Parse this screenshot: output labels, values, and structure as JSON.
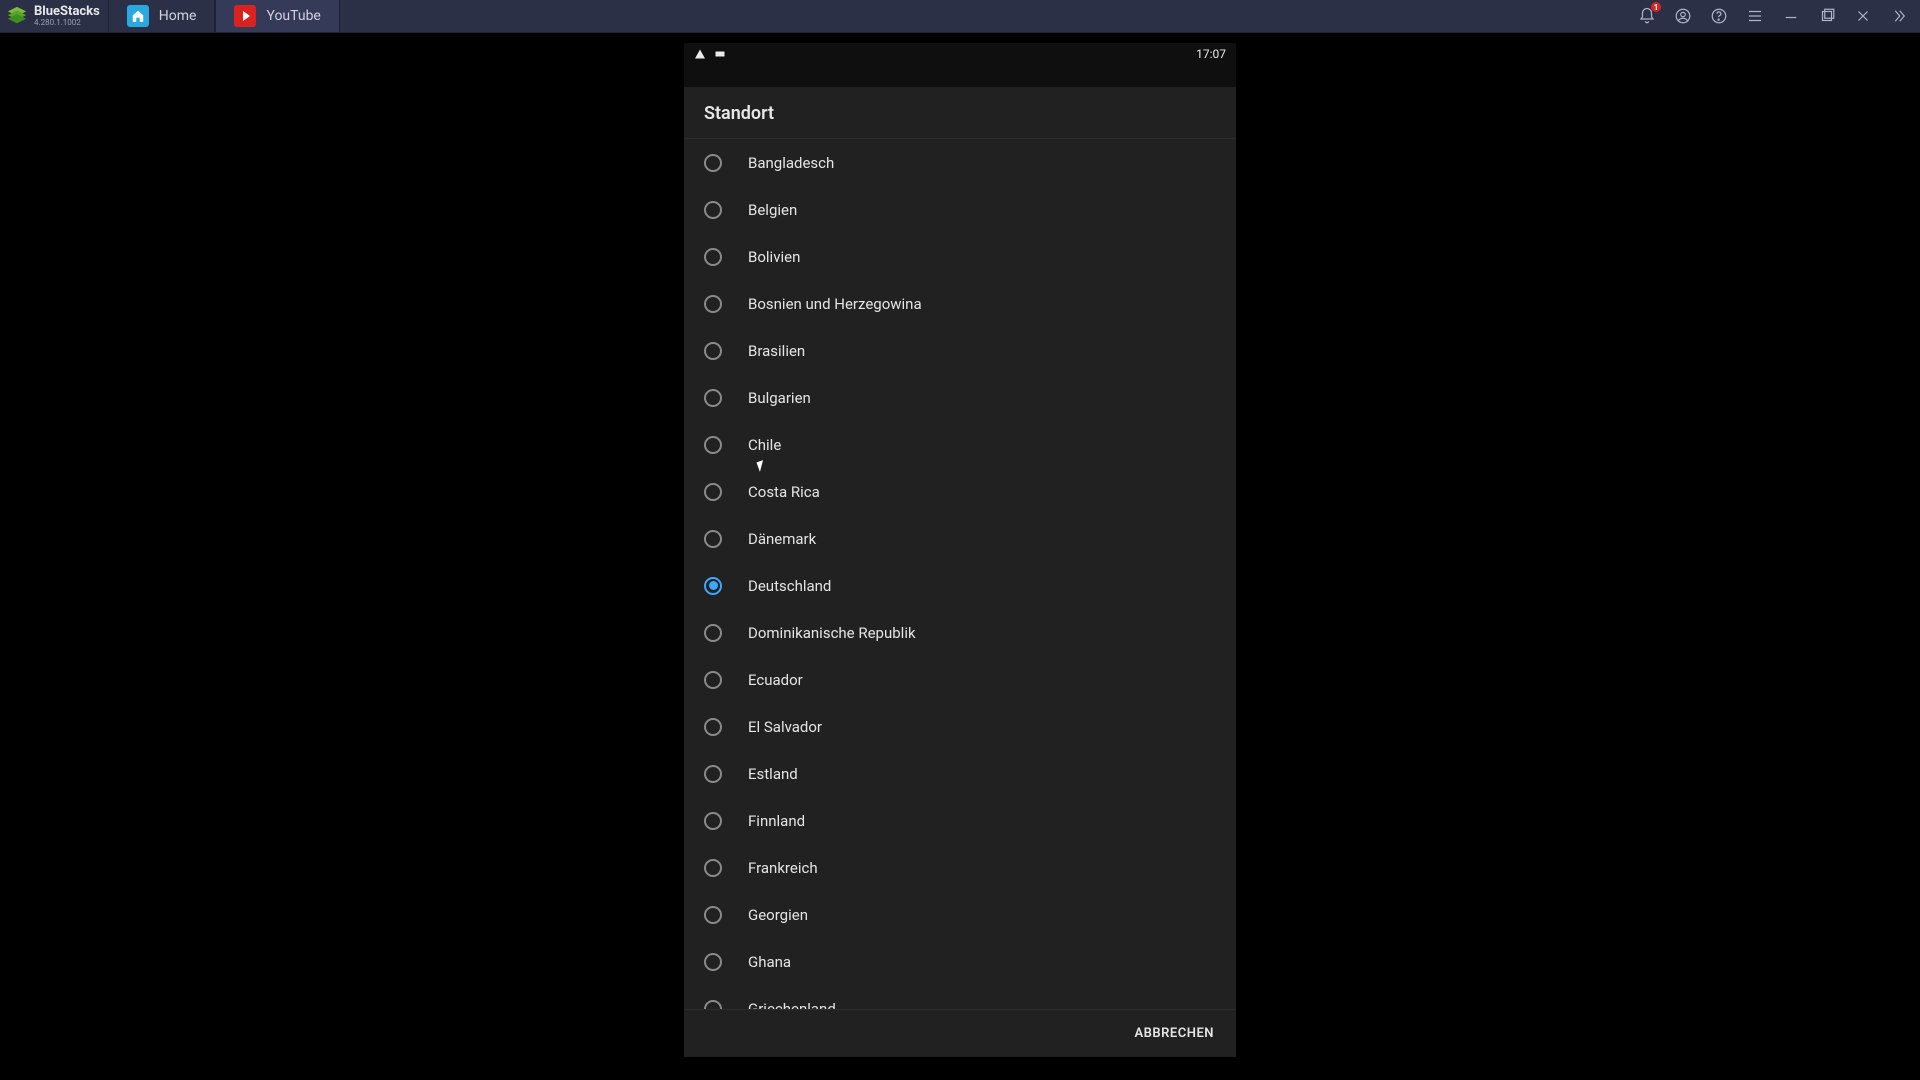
{
  "titlebar": {
    "brand_name": "BlueStacks",
    "brand_version": "4.280.1.1002",
    "tabs": [
      {
        "label": "Home",
        "icon": "home"
      },
      {
        "label": "YouTube",
        "icon": "youtube"
      }
    ],
    "active_tab_index": 1,
    "notification_count": "1"
  },
  "statusbar": {
    "time": "17:07"
  },
  "dialog": {
    "title": "Standort",
    "cancel_label": "ABBRECHEN",
    "selected_index": 9,
    "options": [
      "Bangladesch",
      "Belgien",
      "Bolivien",
      "Bosnien und Herzegowina",
      "Brasilien",
      "Bulgarien",
      "Chile",
      "Costa Rica",
      "Dänemark",
      "Deutschland",
      "Dominikanische Republik",
      "Ecuador",
      "El Salvador",
      "Estland",
      "Finnland",
      "Frankreich",
      "Georgien",
      "Ghana",
      "Griechenland"
    ]
  }
}
